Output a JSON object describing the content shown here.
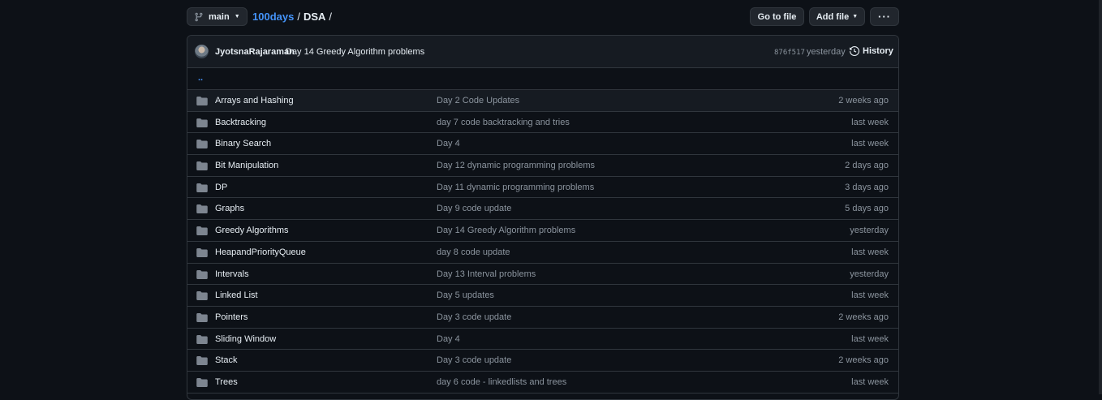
{
  "branch": {
    "label": "main",
    "icon": "git-branch-icon"
  },
  "breadcrumb": {
    "repo": "100days",
    "sep1": "/",
    "folder": "DSA",
    "sep2": "/"
  },
  "toolbar": {
    "goto_label": "Go to file",
    "addfile_label": "Add file",
    "more_label": "···"
  },
  "commit": {
    "author": "JyotsnaRajaraman",
    "message": "Day 14 Greedy Algorithm problems",
    "sha": "876f517",
    "time": "yesterday",
    "history_label": "History"
  },
  "parent_link": "..",
  "files": [
    {
      "name": "Arrays and Hashing",
      "message": "Day 2 Code Updates",
      "time": "2 weeks ago"
    },
    {
      "name": "Backtracking",
      "message": "day 7 code backtracking and tries",
      "time": "last week"
    },
    {
      "name": "Binary Search",
      "message": "Day 4",
      "time": "last week"
    },
    {
      "name": "Bit Manipulation",
      "message": "Day 12 dynamic programming problems",
      "time": "2 days ago"
    },
    {
      "name": "DP",
      "message": "Day 11 dynamic programming problems",
      "time": "3 days ago"
    },
    {
      "name": "Graphs",
      "message": "Day 9 code update",
      "time": "5 days ago"
    },
    {
      "name": "Greedy Algorithms",
      "message": "Day 14 Greedy Algorithm problems",
      "time": "yesterday"
    },
    {
      "name": "HeapandPriorityQueue",
      "message": "day 8 code update",
      "time": "last week"
    },
    {
      "name": "Intervals",
      "message": "Day 13 Interval problems",
      "time": "yesterday"
    },
    {
      "name": "Linked List",
      "message": "Day 5 updates",
      "time": "last week"
    },
    {
      "name": "Pointers",
      "message": "Day 3 code update",
      "time": "2 weeks ago"
    },
    {
      "name": "Sliding Window",
      "message": "Day 4",
      "time": "last week"
    },
    {
      "name": "Stack",
      "message": "Day 3 code update",
      "time": "2 weeks ago"
    },
    {
      "name": "Trees",
      "message": "day 6 code - linkedlists and trees",
      "time": "last week"
    }
  ],
  "colors": {
    "bg": "#0d1117",
    "border": "#30363d",
    "link": "#4493f8",
    "muted": "#8b949e",
    "folder": "#7d8590"
  }
}
